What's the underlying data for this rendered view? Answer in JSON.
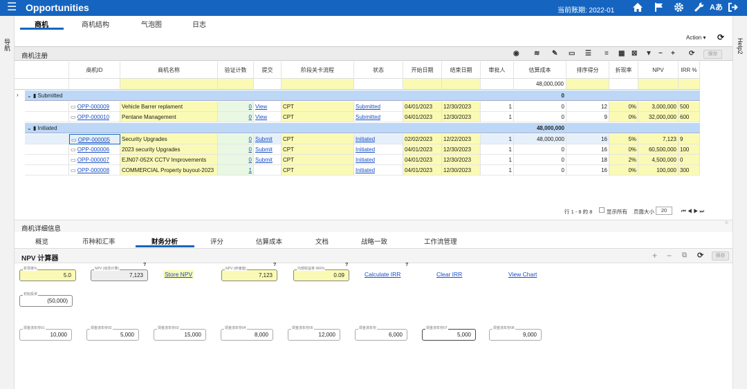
{
  "app": {
    "title": "Opportunities",
    "menu_icon": "☰",
    "period_label": "当前账期: 2022-01",
    "icons": [
      "home-icon",
      "flag-icon",
      "gear-icon",
      "wrench-icon",
      "translate-icon",
      "logout-icon"
    ],
    "translate_glyph": "Aあ"
  },
  "sidebar_left": {
    "label": "导航"
  },
  "sidebar_right": {
    "label": "Help2"
  },
  "top_tabs": [
    "商机",
    "商机结构",
    "气泡图",
    "日志"
  ],
  "action_label": "Action ▾",
  "grid_panel": {
    "title": "商机注册",
    "save_label": "保存"
  },
  "columns": [
    "商机ID",
    "商机名称",
    "验证计数",
    "提交",
    "阶段关卡流程",
    "状态",
    "开始日期",
    "结束日期",
    "审批人",
    "估算成本",
    "排序得分",
    "折现率",
    "NPV",
    "IRR %"
  ],
  "filter_total": "48,000,000",
  "groups": [
    {
      "name": "Submitted",
      "total": "0",
      "rows": [
        {
          "id": "OPP-000009",
          "name": "Vehicle Barrer replament",
          "count": "0",
          "submit": "View",
          "process": "CPT",
          "status": "Submitted",
          "start": "04/01/2023",
          "end": "12/30/2023",
          "approver": "1",
          "cost": "0",
          "score": "12",
          "rate": "0%",
          "npv": "3,000,000",
          "irr": "500"
        },
        {
          "id": "OPP-000010",
          "name": "Pentane Management",
          "count": "0",
          "submit": "View",
          "process": "CPT",
          "status": "Submitted",
          "start": "04/01/2023",
          "end": "12/30/2023",
          "approver": "1",
          "cost": "0",
          "score": "9",
          "rate": "0%",
          "npv": "32,000,000",
          "irr": "600"
        }
      ]
    },
    {
      "name": "Initiated",
      "total": "48,000,000",
      "rows": [
        {
          "id": "OPP-000005",
          "name": "Security Upgrades",
          "count": "0",
          "submit": "Submit",
          "process": "CPT",
          "status": "Initiated",
          "start": "02/02/2023",
          "end": "12/22/2023",
          "approver": "1",
          "cost": "48,000,000",
          "score": "16",
          "rate": "5%",
          "npv": "7,123",
          "irr": "9"
        },
        {
          "id": "OPP-000006",
          "name": "2023 security Upgrades",
          "count": "0",
          "submit": "Submit",
          "process": "CPT",
          "status": "Initiated",
          "start": "04/01/2023",
          "end": "12/30/2023",
          "approver": "1",
          "cost": "0",
          "score": "16",
          "rate": "0%",
          "npv": "60,500,000",
          "irr": "100"
        },
        {
          "id": "OPP-000007",
          "name": "EJN07-052X CCTV Improvements",
          "count": "0",
          "submit": "Submit",
          "process": "CPT",
          "status": "Initiated",
          "start": "04/01/2023",
          "end": "12/30/2023",
          "approver": "1",
          "cost": "0",
          "score": "18",
          "rate": "2%",
          "npv": "4,500,000",
          "irr": "0"
        },
        {
          "id": "OPP-000008",
          "name": "COMMERCIAL Property buyout-2023",
          "count": "1",
          "submit": "",
          "process": "CPT",
          "status": "Initiated",
          "start": "04/01/2023",
          "end": "12/30/2023",
          "approver": "1",
          "cost": "0",
          "score": "16",
          "rate": "0%",
          "npv": "100,000",
          "irr": "300"
        }
      ]
    }
  ],
  "pager": {
    "range": "行 1 - 8 的 8",
    "show_all": "显示所有",
    "page_size_label": "页面大小",
    "page_size": "20",
    "nav": "⏮  ◀  ▶  ⏭"
  },
  "detail": {
    "title": "商机详细信息",
    "tabs": [
      "概览",
      "币种和汇率",
      "财务分析",
      "评分",
      "估算成本",
      "文档",
      "战略一致",
      "工作流管理"
    ]
  },
  "npv": {
    "title": "NPV 计算器",
    "save_label": "保存",
    "fields": {
      "discount": {
        "label": "折现率%",
        "value": "5.0"
      },
      "npv_calc": {
        "label": "NPV (动态计算)",
        "value": "7,123"
      },
      "npv_stored": {
        "label": "NPV (存储值)",
        "value": "7,123"
      },
      "irr": {
        "label": "内部收益率 IRR%",
        "value": "0.09"
      },
      "initial": {
        "label": "初始投资",
        "value": "(50,000)"
      }
    },
    "links": {
      "store_npv": "Store NPV",
      "calc_irr": "Calculate IRR",
      "clear_irr": "Clear IRR",
      "view_chart": "View Chart"
    },
    "help": "?",
    "cashflows": [
      {
        "label": "现金流年份01",
        "value": "10,000"
      },
      {
        "label": "现金流年份02",
        "value": "5,000"
      },
      {
        "label": "现金流年份03",
        "value": "15,000"
      },
      {
        "label": "现金流年份04",
        "value": "8,000"
      },
      {
        "label": "现金流年份05",
        "value": "12,000"
      },
      {
        "label": "现金流年份",
        "value": "6,000"
      },
      {
        "label": "现金流年份07",
        "value": "5,000"
      },
      {
        "label": "现金流年份08",
        "value": "9,000"
      }
    ]
  }
}
